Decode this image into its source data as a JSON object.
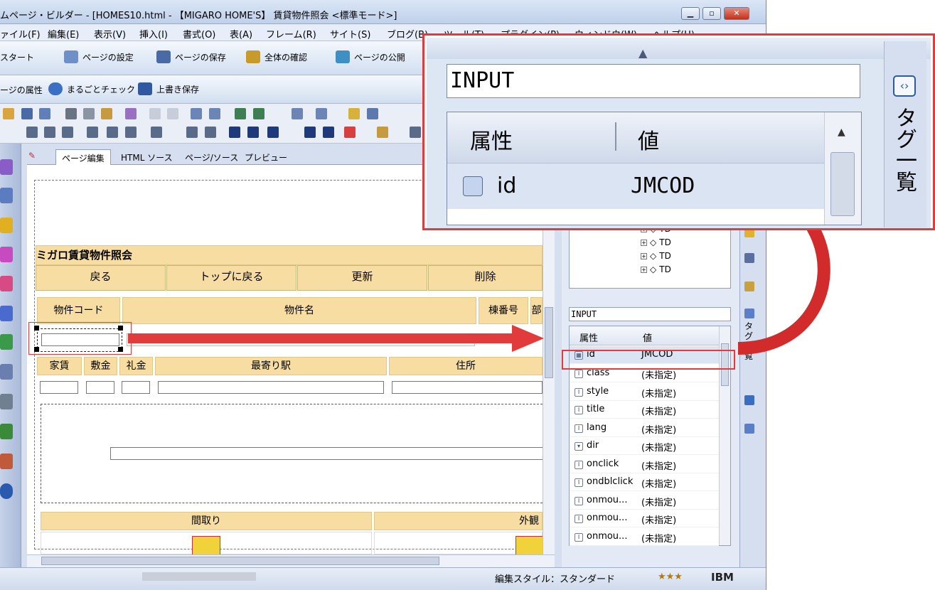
{
  "window": {
    "title": "ムページ・ビルダー - [HOMES10.html - 【MIGARO HOME'S】 賃貸物件照会 <標準モード>]",
    "minimize": "▁",
    "maximize": "▫",
    "close": "✕"
  },
  "menu": [
    "ァイル(F)",
    "編集(E)",
    "表示(V)",
    "挿入(I)",
    "書式(O)",
    "表(A)",
    "フレーム(R)",
    "サイト(S)",
    "ブログ(B)",
    "ツール(T)",
    "プラグイン(P)",
    "ウィンドウ(W)",
    "ヘルプ(H)"
  ],
  "toolbar1": [
    "スタート",
    "ページの設定",
    "ページの保存",
    "全体の確認",
    "ページの公開"
  ],
  "toolbar2": [
    "ージの属性",
    "まるごとチェック",
    "上書き保存"
  ],
  "tabs": [
    "ページ編集",
    "HTML ソース",
    "ページ/ソース",
    "プレビュー"
  ],
  "page": {
    "title": "ミガロ賃貸物件照会",
    "buttons": [
      "戻る",
      "トップに戻る",
      "更新",
      "削除"
    ],
    "row1": [
      "物件コード",
      "物件名",
      "棟番号",
      "部"
    ],
    "row2": [
      "家賃",
      "敷金",
      "礼金",
      "最寄り駅",
      "住所"
    ],
    "row3": [
      "間取り",
      "外観"
    ]
  },
  "panel": {
    "tree_items": [
      "TD",
      "TD",
      "TD",
      "TD"
    ],
    "input_value": "INPUT",
    "attr_header": "属性",
    "value_header": "値",
    "attributes": [
      {
        "name": "id",
        "value": "JMCOD"
      },
      {
        "name": "class",
        "value": "(未指定)"
      },
      {
        "name": "style",
        "value": "(未指定)"
      },
      {
        "name": "title",
        "value": "(未指定)"
      },
      {
        "name": "lang",
        "value": "(未指定)"
      },
      {
        "name": "dir",
        "value": "(未指定)"
      },
      {
        "name": "onclick",
        "value": "(未指定)"
      },
      {
        "name": "ondblclick",
        "value": "(未指定)"
      },
      {
        "name": "onmou...",
        "value": "(未指定)"
      },
      {
        "name": "onmou...",
        "value": "(未指定)"
      },
      {
        "name": "onmou...",
        "value": "(未指定)"
      }
    ],
    "side_tab": "タグ一覧",
    "side_tab_small": "タグ一覧"
  },
  "status": {
    "style": "編集スタイル：スタンダード",
    "brand": "IBM",
    "stars": "★★★"
  },
  "zoom": {
    "input_value": "INPUT",
    "attr_header": "属性",
    "value_header": "値",
    "attr_name": "id",
    "attr_value": "JMCOD",
    "side_tab": "タグ一覧"
  },
  "colors": {
    "highlight": "#e23b3b",
    "table_header": "#f8dda2",
    "panel_bg": "#dde6f3"
  }
}
